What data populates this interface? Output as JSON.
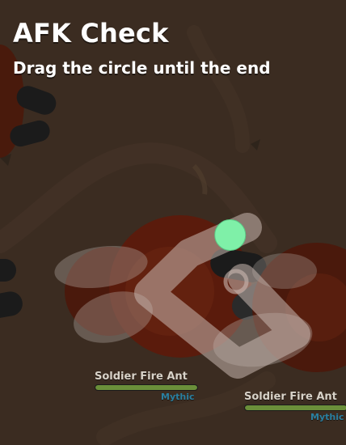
{
  "afk": {
    "title": "AFK Check",
    "instruction": "Drag the circle until the end",
    "handle_color": "#7ff0a8",
    "progress": 0.05
  },
  "mobs": [
    {
      "name": "Soldier Fire Ant",
      "rarity": "Mythic",
      "health": 1.0,
      "bar_color": "#6b8f3a",
      "rarity_color": "#2a7fa0"
    },
    {
      "name": "Soldier Fire Ant",
      "rarity": "Mythic",
      "health": 1.0,
      "bar_color": "#6b8f3a",
      "rarity_color": "#2a7fa0"
    }
  ],
  "colors": {
    "ground": "#3b2c21",
    "fire_ant": "#5a1b0c",
    "track": "#c9b8b0"
  }
}
